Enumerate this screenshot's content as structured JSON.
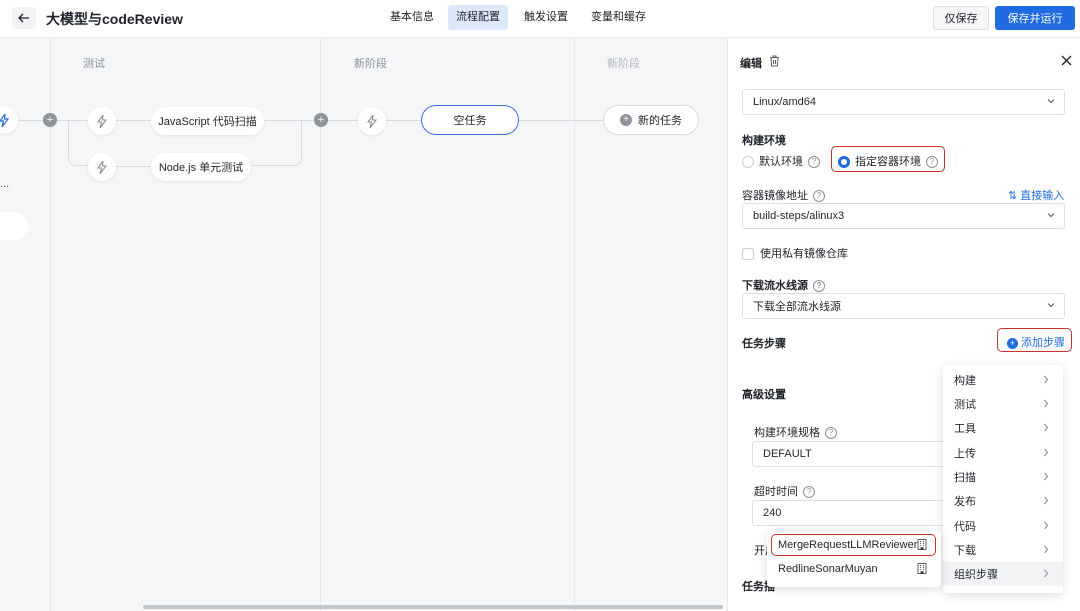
{
  "header": {
    "title": "大模型与codeReview",
    "tabs": [
      {
        "label": "基本信息",
        "active": false
      },
      {
        "label": "流程配置",
        "active": true
      },
      {
        "label": "触发设置",
        "active": false
      },
      {
        "label": "变量和缓存",
        "active": false
      }
    ],
    "save_label": "仅保存",
    "save_run_label": "保存并运行"
  },
  "canvas": {
    "stages": [
      {
        "label": "测试"
      },
      {
        "label": "新阶段"
      },
      {
        "label": "新阶段"
      }
    ],
    "left_stub_text": "...",
    "tasks": {
      "js_scan": "JavaScript 代码扫描",
      "node_test": "Node.js 单元测试",
      "empty_task": "空任务",
      "new_task": "新的任务"
    }
  },
  "panel": {
    "title": "编辑",
    "os_value": "Linux/amd64",
    "build_env": {
      "label": "构建环境",
      "option_default": "默认环境",
      "option_custom": "指定容器环境",
      "selected": "指定容器环境"
    },
    "image": {
      "label": "容器镜像地址",
      "direct_input": "直接输入",
      "value": "build-steps/alinux3"
    },
    "private_repo_label": "使用私有镜像仓库",
    "download_source": {
      "label": "下载流水线源",
      "value": "下载全部流水线源"
    },
    "steps": {
      "label": "任务步骤",
      "add_label": "添加步骤"
    },
    "advanced": {
      "label": "高级设置",
      "spec_label": "构建环境规格",
      "spec_value": "DEFAULT",
      "timeout_label": "超时时间",
      "timeout_value": "240",
      "open_label_partial": "开启",
      "task_plugin_partial": "任务插"
    }
  },
  "menu": {
    "items": [
      "构建",
      "测试",
      "工具",
      "上传",
      "扫描",
      "发布",
      "代码",
      "下载",
      "组织步骤"
    ],
    "hovered": "组织步骤"
  },
  "submenu": {
    "items": [
      "MergeRequestLLMReviewer",
      "RedlineSonarMuyan"
    ],
    "highlighted": "MergeRequestLLMReviewer"
  },
  "colors": {
    "primary": "#1f6bdf",
    "highlight_border": "#c8332e",
    "canvas_bg": "#f5f6f8"
  }
}
